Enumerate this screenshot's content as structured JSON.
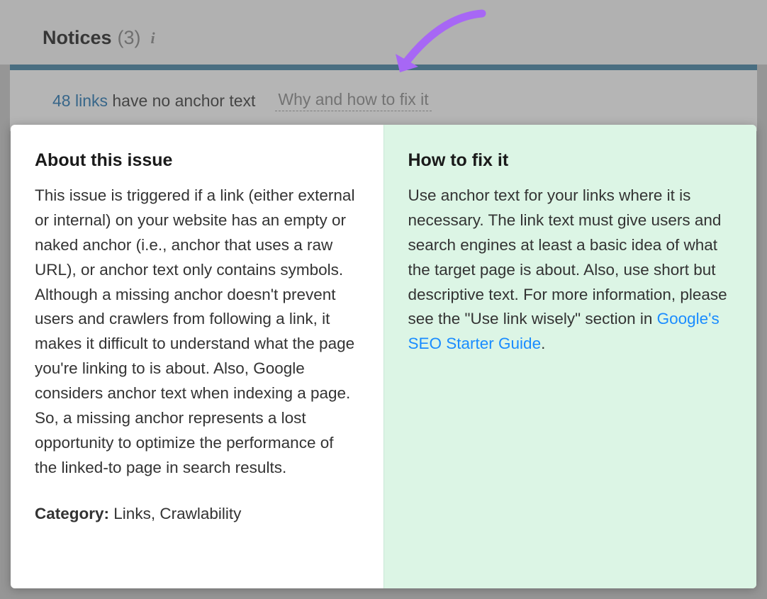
{
  "header": {
    "title": "Notices",
    "count": "(3)"
  },
  "issue": {
    "link_count": "48 links",
    "description": "have no anchor text",
    "fix_hint": "Why and how to fix it"
  },
  "popup": {
    "about": {
      "title": "About this issue",
      "body": "This issue is triggered if a link (either external or internal) on your website has an empty or naked anchor (i.e., anchor that uses a raw URL), or anchor text only contains symbols. Although a missing anchor doesn't prevent users and crawlers from following a link, it makes it difficult to understand what the page you're linking to is about. Also, Google considers anchor text when indexing a page. So, a missing anchor represents a lost opportunity to optimize the performance of the linked-to page in search results.",
      "category_label": "Category:",
      "category_value": "Links, Crawlability"
    },
    "fix": {
      "title": "How to fix it",
      "body_pre": "Use anchor text for your links where it is necessary. The link text must give users and search engines at least a basic idea of what the target page is about. Also, use short but descriptive text. For more information, please see the \"Use link wisely\" section in ",
      "link_text": "Google's SEO Starter Guide",
      "body_post": "."
    }
  }
}
